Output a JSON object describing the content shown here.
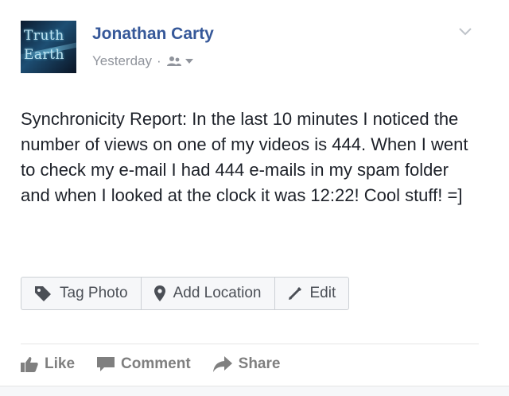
{
  "post": {
    "avatar_text_line1": "Truth",
    "avatar_text_line2": "Earth",
    "author": "Jonathan Carty",
    "timestamp": "Yesterday",
    "meta_separator": "·",
    "audience_icon": "friends-icon",
    "text": "Synchronicity Report: In the last 10 minutes I noticed the number of views on one of my videos is 444. When I went to check my e-mail I had 444 e-mails in my spam folder and when I looked at the clock it was 12:22! Cool stuff! =]"
  },
  "photo_actions": {
    "tag_label": "Tag Photo",
    "location_label": "Add Location",
    "edit_label": "Edit"
  },
  "footer_actions": {
    "like_label": "Like",
    "comment_label": "Comment",
    "share_label": "Share"
  },
  "colors": {
    "author": "#365899",
    "text": "#1d2129",
    "meta": "#90949c",
    "action": "#7f7f7f"
  }
}
